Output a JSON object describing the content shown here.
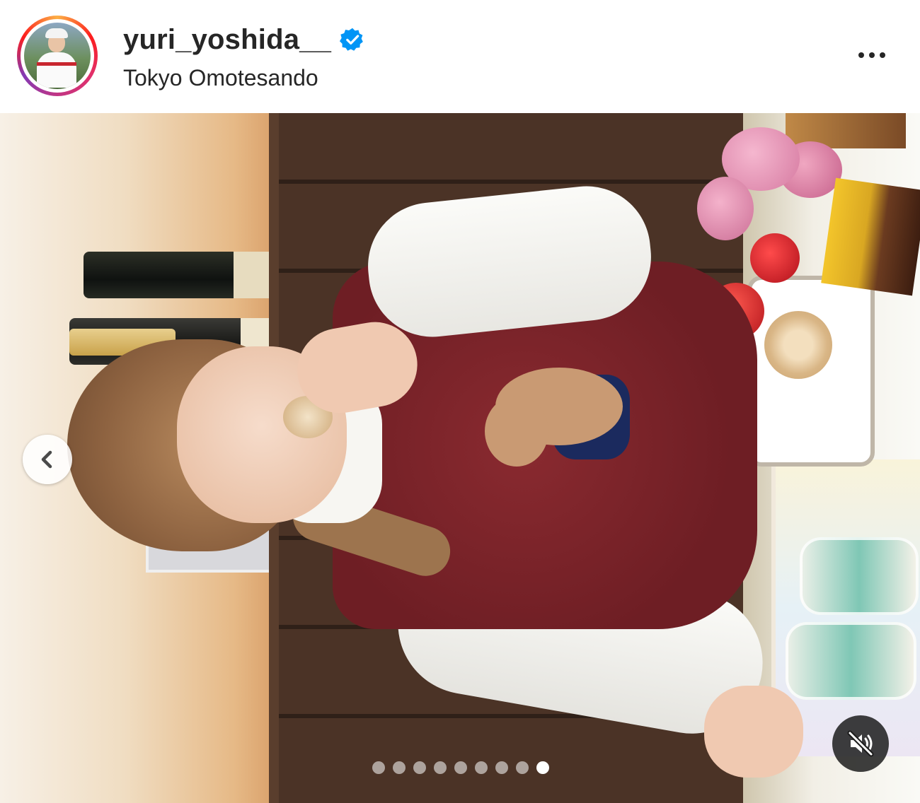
{
  "post_header": {
    "username": "yuri_yoshida__",
    "verified": true,
    "location": "Tokyo Omotesando",
    "more_icon": "more-horizontal-icon"
  },
  "media": {
    "type": "video-carousel",
    "prev_icon": "chevron-left-icon",
    "mute_icon": "volume-muted-icon",
    "carousel": {
      "count": 9,
      "active_index": 8
    }
  },
  "colors": {
    "avatar_ring": [
      "#fcaf45",
      "#fd1d1d",
      "#e1306c",
      "#c13584",
      "#833ab4"
    ],
    "verified_badge": "#0095f6",
    "text": "#262626"
  }
}
